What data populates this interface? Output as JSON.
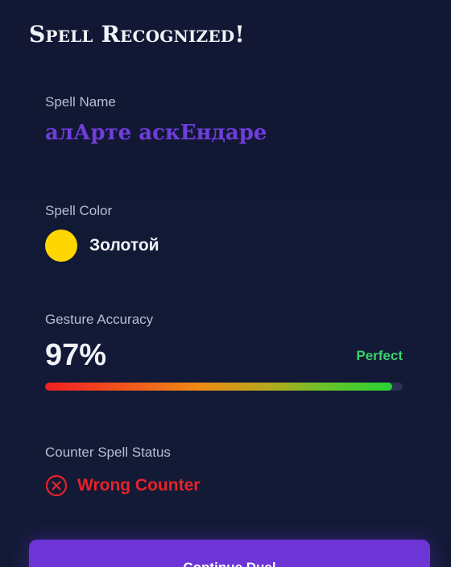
{
  "header": {
    "title": "Spell Recognized!"
  },
  "spell_name": {
    "label": "Spell Name",
    "value": "алАрте аскЕндаре",
    "color": "#6f3ddb"
  },
  "spell_color": {
    "label": "Spell Color",
    "value": "Золотой",
    "swatch_color": "#ffd600"
  },
  "gesture_accuracy": {
    "label": "Gesture Accuracy",
    "value": "97%",
    "percent": 97,
    "rating": "Perfect",
    "rating_color": "#38d26d"
  },
  "counter_spell": {
    "label": "Counter Spell Status",
    "status": "Wrong Counter",
    "icon": "x-circle-icon",
    "status_color": "#e8222a"
  },
  "actions": {
    "continue_label": "Continue Duel",
    "button_color": "#6d35d6"
  }
}
